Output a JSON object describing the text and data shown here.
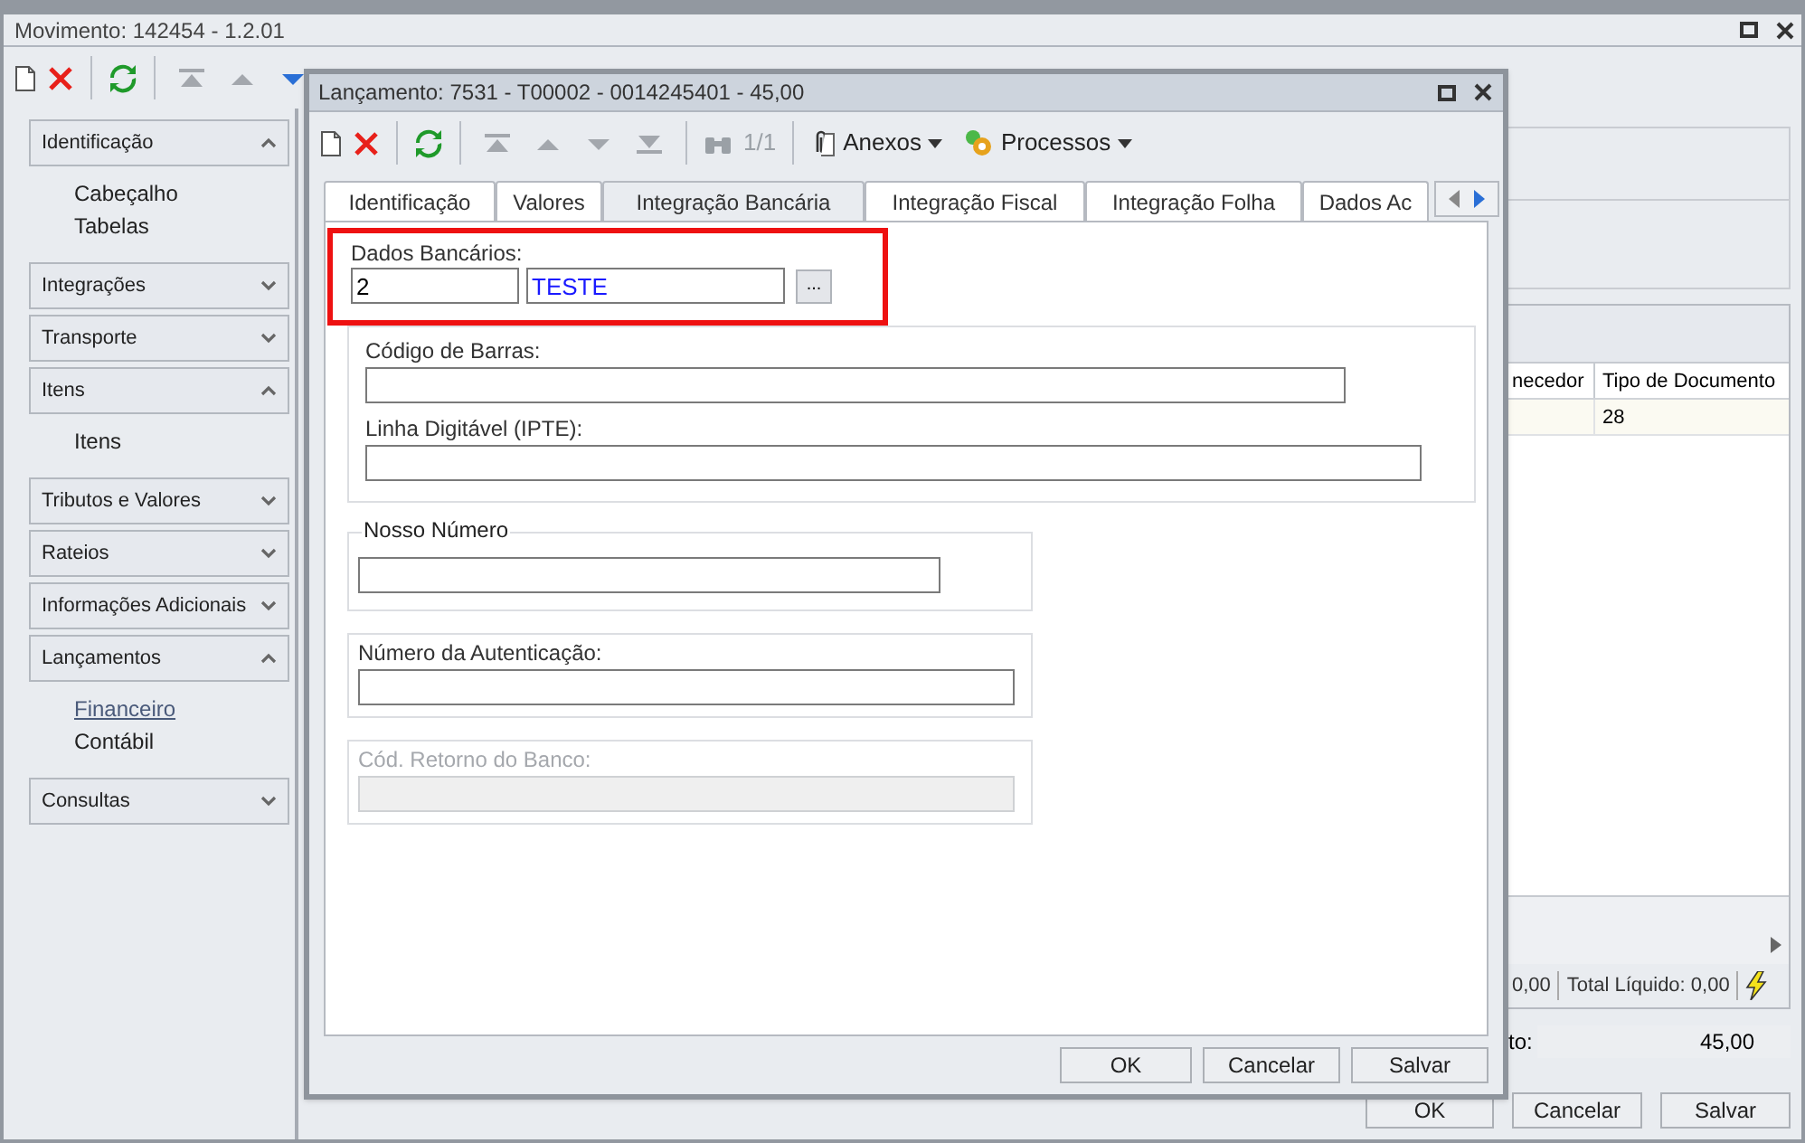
{
  "main_window": {
    "title": "Movimento: 142454 - 1.2.01",
    "nav_buttons": [
      {
        "kind": "first",
        "disabled": true
      },
      {
        "kind": "up",
        "disabled": true
      },
      {
        "kind": "down",
        "disabled": false
      }
    ],
    "sidebar": [
      {
        "label": "Identificação",
        "expanded": true,
        "items": [
          {
            "label": "Cabeçalho",
            "selected": false
          },
          {
            "label": "Tabelas",
            "selected": false
          }
        ]
      },
      {
        "label": "Integrações",
        "expanded": false
      },
      {
        "label": "Transporte",
        "expanded": false
      },
      {
        "label": "Itens",
        "expanded": true,
        "items": [
          {
            "label": "Itens",
            "selected": false
          }
        ]
      },
      {
        "label": "Tributos e Valores",
        "expanded": false
      },
      {
        "label": "Rateios",
        "expanded": false
      },
      {
        "label": "Informações Adicionais",
        "expanded": false
      },
      {
        "label": "Lançamentos",
        "expanded": true,
        "items": [
          {
            "label": "Financeiro",
            "selected": true
          },
          {
            "label": "Contábil",
            "selected": false
          }
        ]
      },
      {
        "label": "Consultas",
        "expanded": false
      }
    ],
    "grid": {
      "columns": [
        "necedor",
        "Tipo de Documento"
      ],
      "rows": [
        {
          "column_2": "28"
        }
      ],
      "totals": [
        "0,00",
        "Total Líquido: 0,00"
      ]
    },
    "amount": {
      "label": "to:",
      "value": "45,00"
    },
    "buttons": [
      "OK",
      "Cancelar",
      "Salvar"
    ]
  },
  "dialog": {
    "title": "Lançamento: 7531 - T00002 - 0014245401 - 45,00",
    "nav_buttons": [
      {
        "kind": "first",
        "disabled": true
      },
      {
        "kind": "up",
        "disabled": true
      },
      {
        "kind": "down",
        "disabled": true
      },
      {
        "kind": "last",
        "disabled": true
      }
    ],
    "counter": {
      "text": "1/1",
      "disabled": true
    },
    "menus": [
      {
        "kind": "attachments",
        "label": "Anexos"
      },
      {
        "kind": "processes",
        "label": "Processos"
      }
    ],
    "tabs": [
      {
        "label": "Identificação",
        "selected": false
      },
      {
        "label": "Valores",
        "selected": false
      },
      {
        "label": "Integração Bancária",
        "selected": true
      },
      {
        "label": "Integração Fiscal",
        "selected": false
      },
      {
        "label": "Integração Folha",
        "selected": false
      },
      {
        "label": "Dados Ac",
        "selected": false
      }
    ],
    "bank_data": {
      "label": "Dados Bancários:",
      "code": "2",
      "name": "TESTE",
      "highlighted": true,
      "lookup": "..."
    },
    "barcode_group": [
      {
        "label": "Código de Barras:"
      },
      {
        "label": "Linha Digitável (IPTE):"
      }
    ],
    "nosso_numero": {
      "legend": "Nosso Número"
    },
    "boxes": [
      {
        "label": "Número da Autenticação:",
        "disabled": false
      },
      {
        "label": "Cód. Retorno do Banco:",
        "disabled": true
      }
    ],
    "buttons": [
      "OK",
      "Cancelar",
      "Salvar"
    ]
  }
}
